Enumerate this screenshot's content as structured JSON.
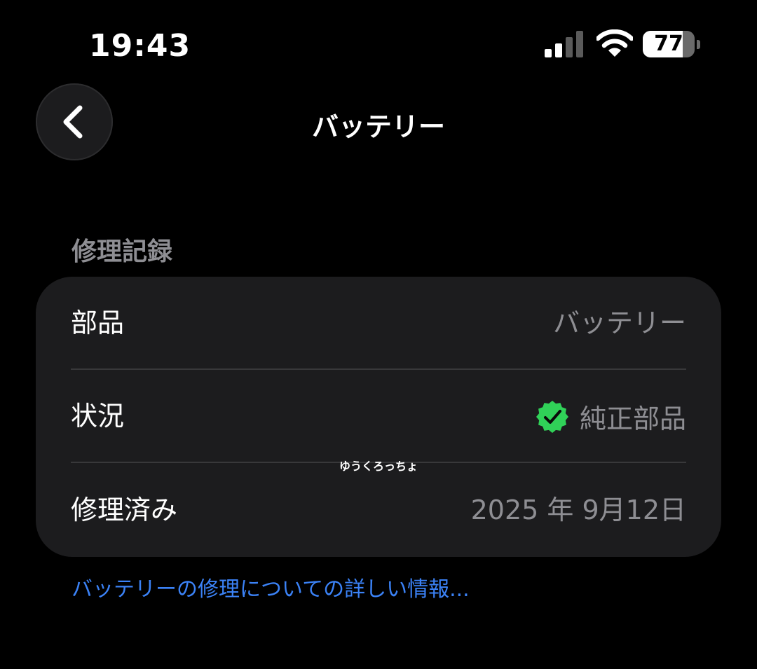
{
  "status_bar": {
    "time": "19:43",
    "battery_level": "77",
    "battery_percent": 77,
    "signal_bars_active": 2,
    "signal_bars_total": 4
  },
  "nav": {
    "title": "バッテリー",
    "back_icon": "chevron-left-icon"
  },
  "section": {
    "header": "修理記録"
  },
  "rows": [
    {
      "label": "部品",
      "value": "バッテリー"
    },
    {
      "label": "状況",
      "value": "純正部品",
      "icon": "verified-check-icon"
    },
    {
      "label": "修理済み",
      "value": "2025 年 9月12日"
    }
  ],
  "watermark": "ゆうくろっちょ",
  "link": {
    "label": "バッテリーの修理についての詳しい情報..."
  },
  "colors": {
    "background": "#000000",
    "card": "#1c1c1e",
    "secondary_text": "#8e8e93",
    "link": "#3b82f6",
    "verified": "#30d158"
  }
}
